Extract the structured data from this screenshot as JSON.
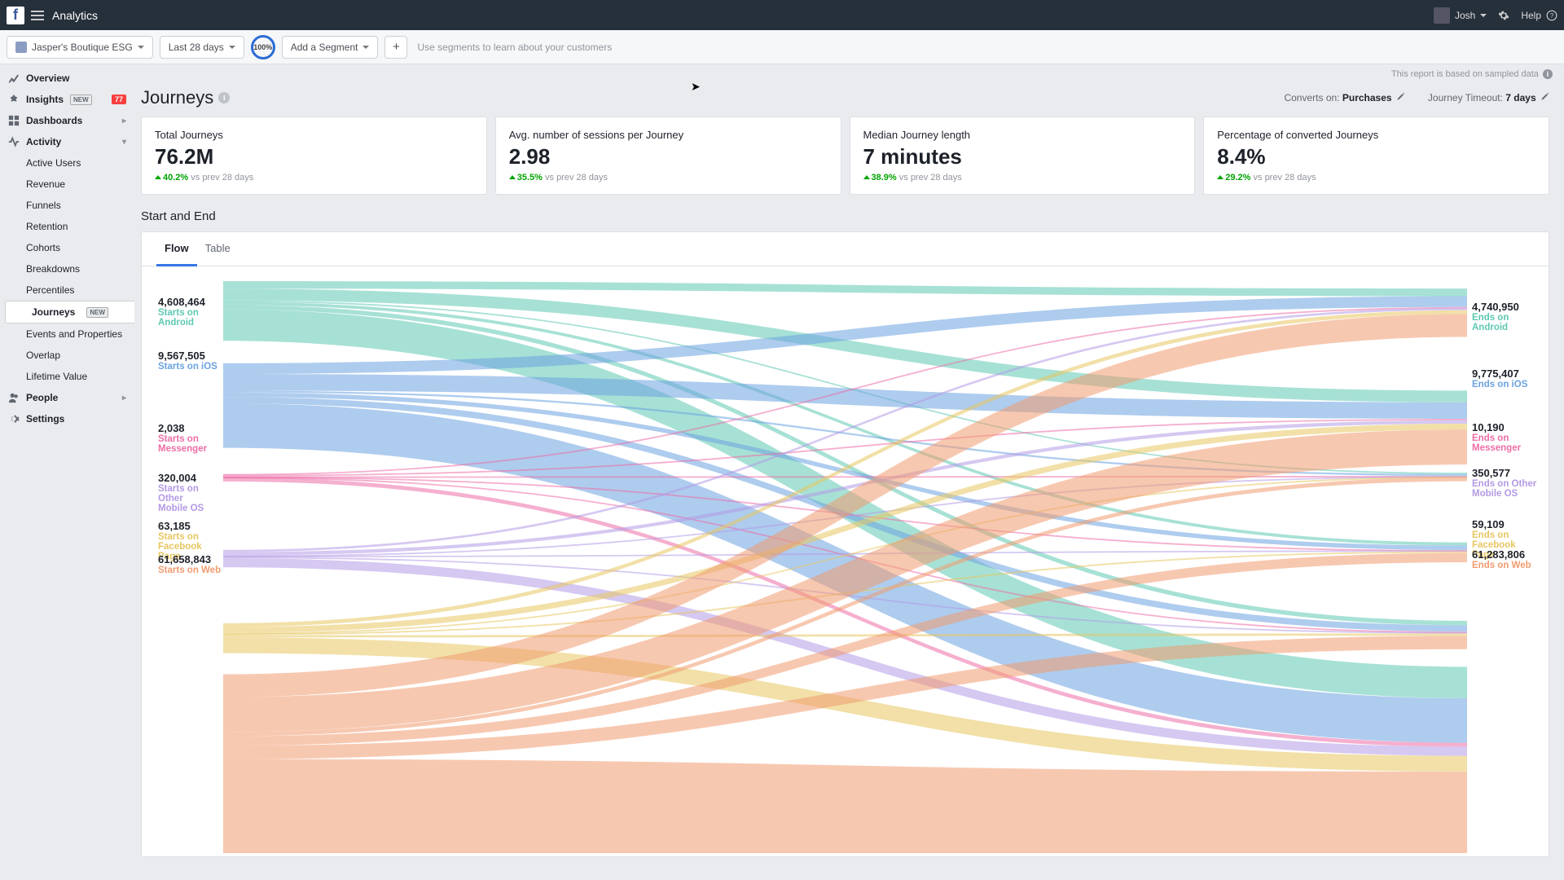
{
  "topbar": {
    "title": "Analytics",
    "user": "Josh",
    "help": "Help"
  },
  "filterbar": {
    "app": "Jasper's Boutique ESG",
    "range": "Last 28 days",
    "pct": "100%",
    "segment": "Add a Segment",
    "hint": "Use segments to learn about your customers"
  },
  "sidebar": {
    "overview": "Overview",
    "insights": "Insights",
    "insights_new": "NEW",
    "insights_count": "77",
    "dashboards": "Dashboards",
    "activity": "Activity",
    "activity_items": [
      "Active Users",
      "Revenue",
      "Funnels",
      "Retention",
      "Cohorts",
      "Breakdowns",
      "Percentiles",
      "Journeys",
      "Events and Properties",
      "Overlap",
      "Lifetime Value"
    ],
    "journeys_new": "NEW",
    "people": "People",
    "settings": "Settings"
  },
  "sampled": "This report is based on sampled data",
  "page": {
    "title": "Journeys",
    "converts_label": "Converts on:",
    "converts_val": "Purchases",
    "timeout_label": "Journey Timeout:",
    "timeout_val": "7 days"
  },
  "cards": [
    {
      "label": "Total Journeys",
      "value": "76.2M",
      "delta": "40.2%",
      "cmp": "vs prev 28 days"
    },
    {
      "label": "Avg. number of sessions per Journey",
      "value": "2.98",
      "delta": "35.5%",
      "cmp": "vs prev 28 days"
    },
    {
      "label": "Median Journey length",
      "value": "7 minutes",
      "delta": "38.9%",
      "cmp": "vs prev 28 days"
    },
    {
      "label": "Percentage of converted Journeys",
      "value": "8.4%",
      "delta": "29.2%",
      "cmp": "vs prev 28 days"
    }
  ],
  "section": "Start and End",
  "tabs": {
    "flow": "Flow",
    "table": "Table"
  },
  "chart_data": {
    "type": "sankey",
    "left": [
      {
        "num": "4,608,464",
        "l1": "Starts on",
        "l2": "Android",
        "color": "#5ec8b2"
      },
      {
        "num": "9,567,505",
        "l1": "Starts on iOS",
        "l2": "",
        "color": "#6ba3e0"
      },
      {
        "num": "2,038",
        "l1": "Starts on",
        "l2": "Messenger",
        "color": "#ed6ea7"
      },
      {
        "num": "320,004",
        "l1": "Starts on Other",
        "l2": "Mobile OS",
        "color": "#b39ae5"
      },
      {
        "num": "63,185",
        "l1": "Starts on",
        "l2": "Facebook Page",
        "color": "#e8c661"
      },
      {
        "num": "61,658,843",
        "l1": "Starts on Web",
        "l2": "",
        "color": "#f19b6f"
      }
    ],
    "right": [
      {
        "num": "4,740,950",
        "l1": "Ends on",
        "l2": "Android",
        "color": "#5ec8b2"
      },
      {
        "num": "9,775,407",
        "l1": "Ends on iOS",
        "l2": "",
        "color": "#6ba3e0"
      },
      {
        "num": "10,190",
        "l1": "Ends on",
        "l2": "Messenger",
        "color": "#ed6ea7"
      },
      {
        "num": "350,577",
        "l1": "Ends on Other",
        "l2": "Mobile OS",
        "color": "#b39ae5"
      },
      {
        "num": "59,109",
        "l1": "Ends on",
        "l2": "Facebook Page",
        "color": "#e8c661"
      },
      {
        "num": "61,283,806",
        "l1": "Ends on Web",
        "l2": "",
        "color": "#f19b6f"
      }
    ]
  }
}
